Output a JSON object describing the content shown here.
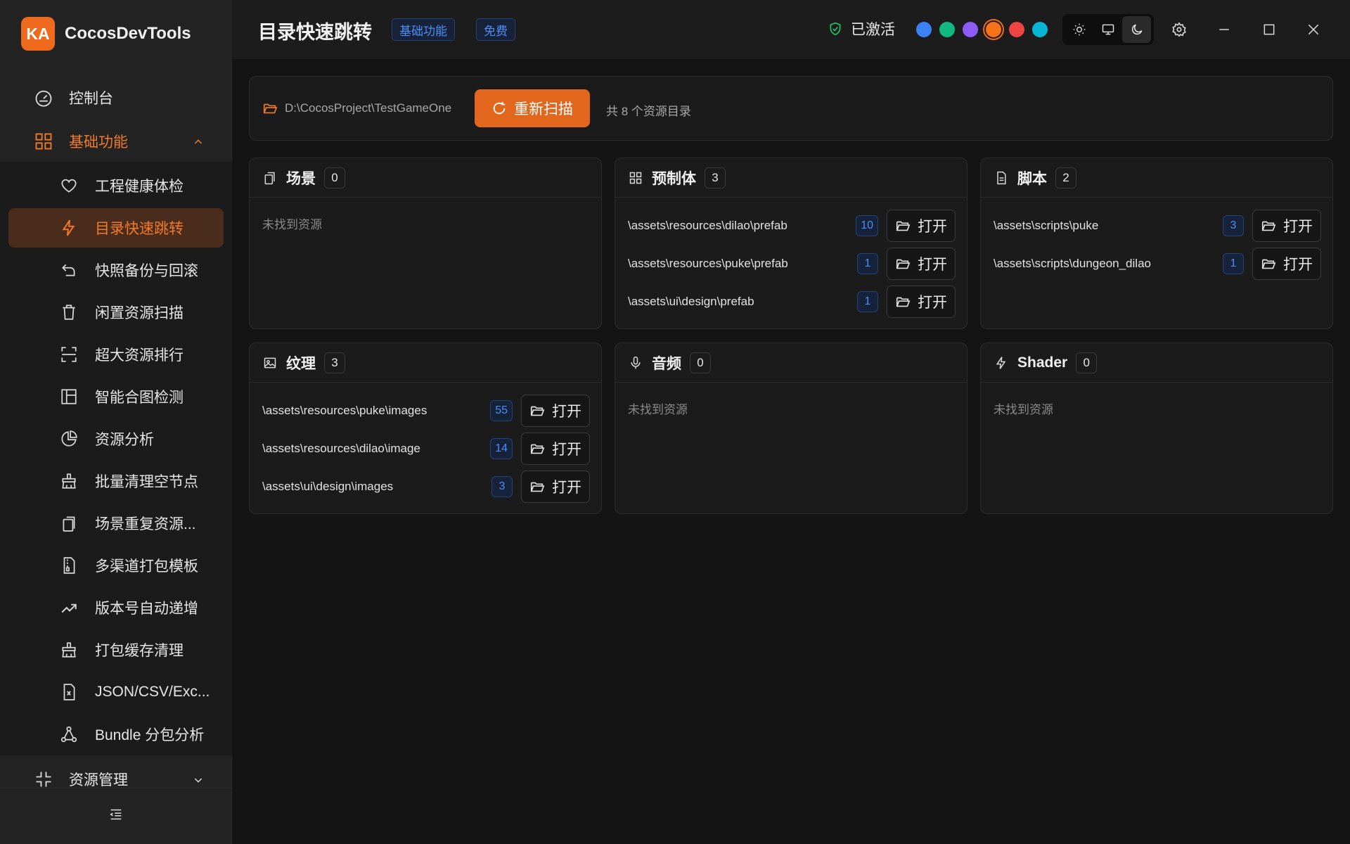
{
  "app": {
    "logo_text": "KA",
    "name": "CocosDevTools"
  },
  "sidebar": {
    "top_items": [
      {
        "label": "控制台",
        "icon": "dashboard-icon"
      },
      {
        "label": "基础功能",
        "icon": "grid-icon",
        "expanded": true
      }
    ],
    "sub_items": [
      {
        "label": "工程健康体检",
        "icon": "heart-icon"
      },
      {
        "label": "目录快速跳转",
        "icon": "bolt-icon",
        "active": true
      },
      {
        "label": "快照备份与回滚",
        "icon": "rollback-icon"
      },
      {
        "label": "闲置资源扫描",
        "icon": "trash-icon"
      },
      {
        "label": "超大资源排行",
        "icon": "scan-icon"
      },
      {
        "label": "智能合图检测",
        "icon": "layout-icon"
      },
      {
        "label": "资源分析",
        "icon": "pie-chart-icon"
      },
      {
        "label": "批量清理空节点",
        "icon": "broom-icon"
      },
      {
        "label": "场景重复资源...",
        "icon": "copy-icon"
      },
      {
        "label": "多渠道打包模板",
        "icon": "file-zip-icon"
      },
      {
        "label": "版本号自动递增",
        "icon": "trend-up-icon"
      },
      {
        "label": "打包缓存清理",
        "icon": "broom-icon"
      },
      {
        "label": "JSON/CSV/Exc...",
        "icon": "file-excel-icon"
      },
      {
        "label": "Bundle 分包分析",
        "icon": "network-icon"
      }
    ],
    "bottom_item": {
      "label": "资源管理",
      "icon": "shrink-icon"
    }
  },
  "header": {
    "title": "目录快速跳转",
    "tags": [
      "基础功能",
      "免费"
    ],
    "status": "已激活",
    "swatches": [
      "#3b82f6",
      "#10b981",
      "#8b5cf6",
      "#f97316",
      "#ef4444",
      "#06b6d4"
    ],
    "selected_swatch": 3
  },
  "pathbar": {
    "path": "D:\\CocosProject\\TestGameOne",
    "rescan_label": "重新扫描",
    "summary": "共 8 个资源目录"
  },
  "empty_text": "未找到资源",
  "open_label": "打开",
  "cards": [
    {
      "title": "场景",
      "icon": "scene-icon",
      "count": "0",
      "rows": []
    },
    {
      "title": "预制体",
      "icon": "grid-icon",
      "count": "3",
      "rows": [
        {
          "path": "\\assets\\resources\\dilao\\prefab",
          "count": "10"
        },
        {
          "path": "\\assets\\resources\\puke\\prefab",
          "count": "1"
        },
        {
          "path": "\\assets\\ui\\design\\prefab",
          "count": "1"
        }
      ]
    },
    {
      "title": "脚本",
      "icon": "file-icon",
      "count": "2",
      "rows": [
        {
          "path": "\\assets\\scripts\\puke",
          "count": "3"
        },
        {
          "path": "\\assets\\scripts\\dungeon_dilao",
          "count": "1"
        }
      ]
    },
    {
      "title": "纹理",
      "icon": "image-icon",
      "count": "3",
      "rows": [
        {
          "path": "\\assets\\resources\\puke\\images",
          "count": "55"
        },
        {
          "path": "\\assets\\resources\\dilao\\image",
          "count": "14"
        },
        {
          "path": "\\assets\\ui\\design\\images",
          "count": "3"
        }
      ]
    },
    {
      "title": "音频",
      "icon": "microphone-icon",
      "count": "0",
      "rows": []
    },
    {
      "title": "Shader",
      "icon": "bolt-icon",
      "count": "0",
      "rows": []
    }
  ]
}
